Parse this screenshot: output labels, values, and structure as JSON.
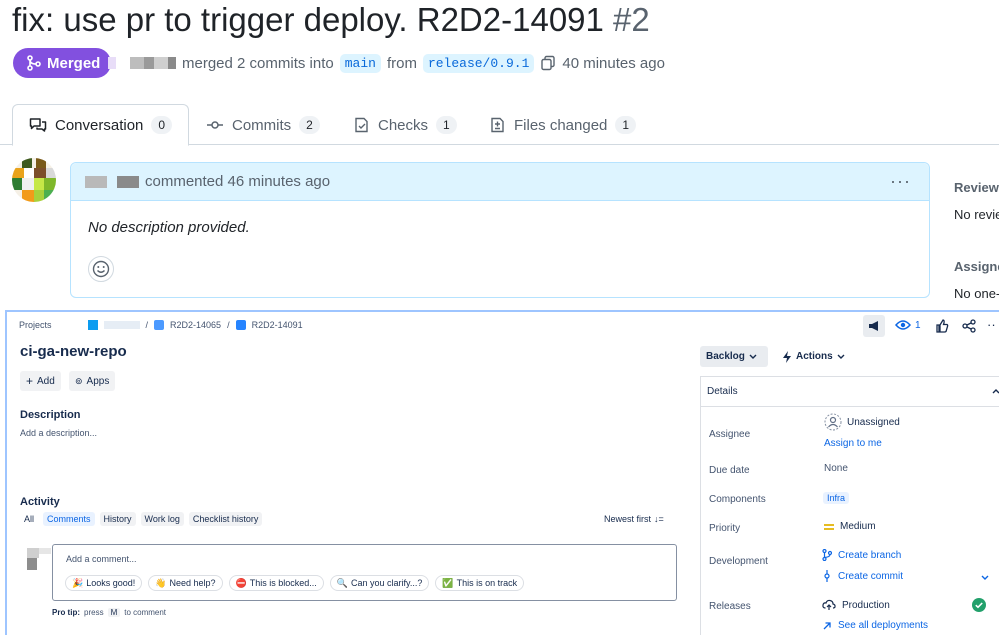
{
  "pr": {
    "title": "fix: use pr to trigger deploy. R2D2-14091",
    "number": "#2",
    "status": "Merged",
    "meta_action": "merged 2 commits into",
    "base_branch": "main",
    "from_word": "from",
    "head_branch": "release/0.9.1",
    "merged_time": "40 minutes ago"
  },
  "tabs": [
    {
      "label": "Conversation",
      "count": "0",
      "icon": "comment-discussion-icon"
    },
    {
      "label": "Commits",
      "count": "2",
      "icon": "git-commit-icon"
    },
    {
      "label": "Checks",
      "count": "1",
      "icon": "checklist-icon"
    },
    {
      "label": "Files changed",
      "count": "1",
      "icon": "file-diff-icon"
    }
  ],
  "comment": {
    "action": "commented 46 minutes ago",
    "body": "No description provided."
  },
  "sidebar": {
    "reviewers_label": "Reviewe",
    "reviewers_value": "No revie",
    "assignees_label": "Assigne",
    "assignees_value": "No one-"
  },
  "jira": {
    "breadcrumb": {
      "projects": "Projects",
      "parent": "R2D2-14065",
      "issue": "R2D2-14091"
    },
    "watch_count": "1",
    "title": "ci-ga-new-repo",
    "add_label": "Add",
    "apps_label": "Apps",
    "status": "Backlog",
    "actions_label": "Actions",
    "description_heading": "Description",
    "description_placeholder": "Add a description...",
    "activity_heading": "Activity",
    "filters": [
      "All",
      "Comments",
      "History",
      "Work log",
      "Checklist history"
    ],
    "sort_label": "Newest first",
    "comment_placeholder": "Add a comment...",
    "quick_replies": [
      {
        "emoji": "🎉",
        "text": "Looks good!"
      },
      {
        "emoji": "👋",
        "text": "Need help?"
      },
      {
        "emoji": "⛔",
        "text": "This is blocked..."
      },
      {
        "emoji": "🔍",
        "text": "Can you clarify...?"
      },
      {
        "emoji": "✅",
        "text": "This is on track"
      }
    ],
    "pro_tip_prefix": "Pro tip:",
    "pro_tip_press": "press",
    "pro_tip_key": "M",
    "pro_tip_suffix": "to comment",
    "details": {
      "heading": "Details",
      "assignee_label": "Assignee",
      "assignee_value": "Unassigned",
      "assign_to_me": "Assign to me",
      "due_date_label": "Due date",
      "due_date_value": "None",
      "components_label": "Components",
      "components_value": "Infra",
      "priority_label": "Priority",
      "priority_value": "Medium",
      "development_label": "Development",
      "create_branch": "Create branch",
      "create_commit": "Create commit",
      "releases_label": "Releases",
      "releases_value": "Production",
      "see_all_deployments": "See all deployments"
    }
  },
  "colors": {
    "merged_purple": "#8250df",
    "github_link": "#0969da",
    "jira_blue": "#0c66e4",
    "priority_orange": "#e2b203",
    "success_green": "#22a06b"
  }
}
